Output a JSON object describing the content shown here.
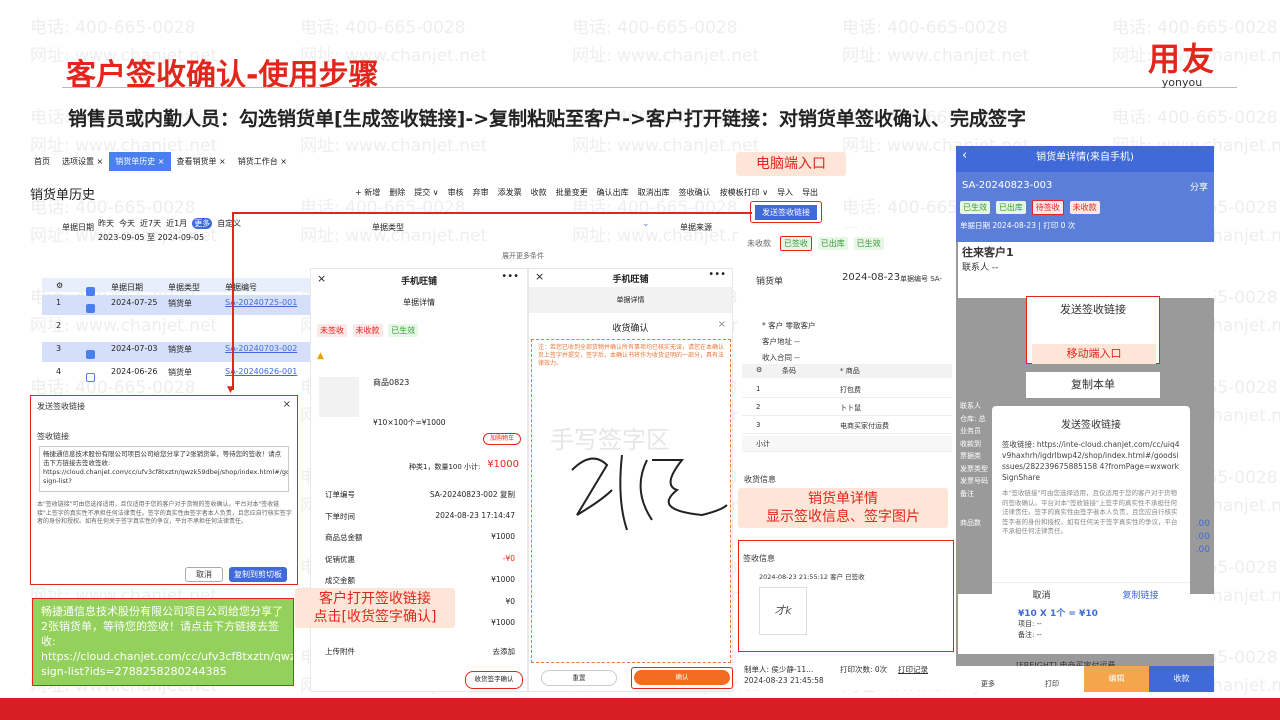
{
  "watermarks": [
    "电话: 400-665-0028",
    "网址: www.chanjet.net"
  ],
  "title": "客户签收确认-使用步骤",
  "logo": {
    "brand": "用友",
    "sub": "yonyou"
  },
  "subtitle": "销售员或内勤人员：勾选销货单[生成签收链接]->复制粘贴至客户->客户打开链接：对销货单签收确认、完成签字",
  "pc": {
    "tabs": [
      "首页",
      "选项设置 ×",
      "销货单历史 ×",
      "查看销货单 ×",
      "销货工作台 ×"
    ],
    "page_title": "销货单历史",
    "toolbar": [
      "+ 新增",
      "删除",
      "提交 ∨",
      "审核",
      "弃审",
      "添发票",
      "收款",
      "批量变更",
      "确认出库",
      "取消出库",
      "签收确认",
      "按模板打印 ∨",
      "导入",
      "导出"
    ],
    "send_btn": "发送签收链接",
    "filter_label": "单据日期",
    "filter_opts": [
      "昨天",
      "今天",
      "近7天",
      "近1月",
      "更多",
      "自定义"
    ],
    "date_range": "2023-09-05 至 2024-09-05",
    "doc_type": "单据类型",
    "doc_source": "单据来源",
    "expand": "展开更多条件",
    "cols": [
      "单据日期",
      "单据类型",
      "单据编号"
    ],
    "rows": [
      {
        "no": "1",
        "date": "2024-07-25",
        "type": "销货单",
        "code": "SA-20240725-001",
        "checked": true
      },
      {
        "no": "2",
        "date": "",
        "type": "",
        "code": "",
        "checked": false
      },
      {
        "no": "3",
        "date": "2024-07-03",
        "type": "销货单",
        "code": "SA-20240703-002",
        "checked": true
      },
      {
        "no": "4",
        "date": "2024-06-26",
        "type": "销货单",
        "code": "SA-20240626-001",
        "checked": false
      }
    ]
  },
  "dialog": {
    "title": "发送签收链接",
    "label": "签收链接",
    "text": "畅捷通信息技术股份有限公司项目公司给您分享了2张销货单，等待您的签收！请点击下方链接去签收签收: https://cloud.chanjet.com/cc/ufv3cf8txztn/qwzk59dbej/shop/index.html#/goodsissue-sign-list?",
    "notice": "本\"签收链接\"可由您选择适用，且仅适用于您的客户对于货物的签收确认。平台对本\"签收链接\"上签字的真实性不承担任何法律责任。签字的真实性由签字者本人负责，且您应自行核实签字者的身份和授权。如有任何关于签字真实性的争议，平台不承担任何法律责任。",
    "cancel": "取消",
    "copy": "复制到剪切板"
  },
  "green_msg": "畅捷通信息技术股份有限公司项目公司给您分享了2张销货单，等待您的签收！请点击下方链接去签收: https://cloud.chanjet.com/cc/ufv3cf8txztn/qwzk59dbej/shop/index.html#/goodsissue-sign-list?ids=2788258280244385",
  "ann": {
    "pc": "电脑端入口",
    "customer": "客户打开签收链接\n点击[收货签字确认]",
    "detail": "销货单详情\n显示签收信息、签字图片",
    "mobile": "移动端入口",
    "sign_area": "手写签字区"
  },
  "phone1": {
    "app": "手机旺铺",
    "sub": "单据详情",
    "tags": [
      "未签收",
      "未收款",
      "已生效"
    ],
    "product": "商品0823",
    "price": "¥10×100个=¥1000",
    "add_btn": "加购物车",
    "summary_l": "种类1，数量100  小计:",
    "summary_r": "¥1000",
    "fields": [
      [
        "订单编号",
        "SA-20240823-002 复制"
      ],
      [
        "下单时间",
        "2024-08-23 17:14:47"
      ],
      [
        "商品总金额",
        "¥1000"
      ],
      [
        "促销优惠",
        "-¥0"
      ],
      [
        "成交金额",
        "¥1000"
      ],
      [
        "",
        "¥0"
      ],
      [
        "",
        "¥1000"
      ],
      [
        "上传附件",
        "去添加"
      ]
    ],
    "confirm_btn": "收货签字确认"
  },
  "phone2": {
    "app": "手机旺铺",
    "sub": "单据详情",
    "dialog": "收货确认",
    "warn": "注：若您已收到全部货物并确认所有事项均已核实无误，请您在本确认页上签字并提交，签字后，本确认书将作为收货证明的一部分，具有法律效力。",
    "reset": "重置",
    "ok": "确认"
  },
  "detail": {
    "tags": [
      "未收款",
      "已签收",
      "已出库",
      "已生效"
    ],
    "tab": "销货单",
    "date": "2024-08-23",
    "doc_no": "单据编号 SA-",
    "fields": [
      "* 客户  零散客户",
      "客户地址  --",
      "收入合同  --"
    ],
    "cols": [
      "",
      "条码",
      "* 商品"
    ],
    "rows": [
      [
        "1",
        "",
        "打包费"
      ],
      [
        "2",
        "",
        "卜卜鼠"
      ],
      [
        "3",
        "",
        "电商买家付运费"
      ],
      [
        "小计",
        "",
        ""
      ]
    ],
    "recv": "收货信息",
    "sign_title": "签收信息",
    "sign_line": "2024-08-23 21:55:12 客户 已签收",
    "maker": "制单人: 侯少静-11...",
    "maker_time": "2024-08-23 21:45:58",
    "print_cnt": "打印次数: 0次",
    "print_rec": "打印记录"
  },
  "mobile": {
    "head": "销货单详情(来自手机)",
    "code": "SA-20240823-003",
    "share": "分享",
    "tags": [
      "已生效",
      "已出库",
      "待签收",
      "未收款"
    ],
    "date": "单据日期 2024-08-23 | 打印 0 次",
    "customer": "往来客户1",
    "contact": "联系人 --",
    "wh": "仓库 总仓",
    "menu1": "发送签收链接",
    "menu2": "复制本单",
    "dlg_title": "发送签收链接",
    "dlg_link": "签收链接: https://inte-cloud.chanjet.com/cc/uiq4v9haxhrh/igdrlbwp42/shop/index.html#/goodsissues/282239675885158 4?fromPage=wxworkSignShare",
    "dlg_note": "本\"签收链接\"可由您选择适用，且仅适用于您的客户对于货物的签收确认。平台对本\"签收链接\"上签字的真实性不承担任何法律责任。签字的真实性由签字者本人负责，且您应自行核实签字者的身份和授权，如有任何关于签字真实性的争议，平台不承担任何法律责任。",
    "dlg_cancel": "取消",
    "dlg_copy": "复制链接",
    "left_lbl": [
      "联系人",
      "仓库: 总",
      "业务员",
      "收款到",
      "票据类",
      "发票类型",
      "发票号码",
      "备注"
    ],
    "item": "¥10 X 1个 = ¥10",
    "item_sub": "项目: --",
    "item_note": "备注: --",
    "freight": "[FREIGHT] 电商买家付运费",
    "bottom": [
      "更多",
      "打印",
      "编辑",
      "收款"
    ],
    "amounts": [
      ".00",
      ".00",
      ".00"
    ],
    "item_lbl": "商品数"
  }
}
